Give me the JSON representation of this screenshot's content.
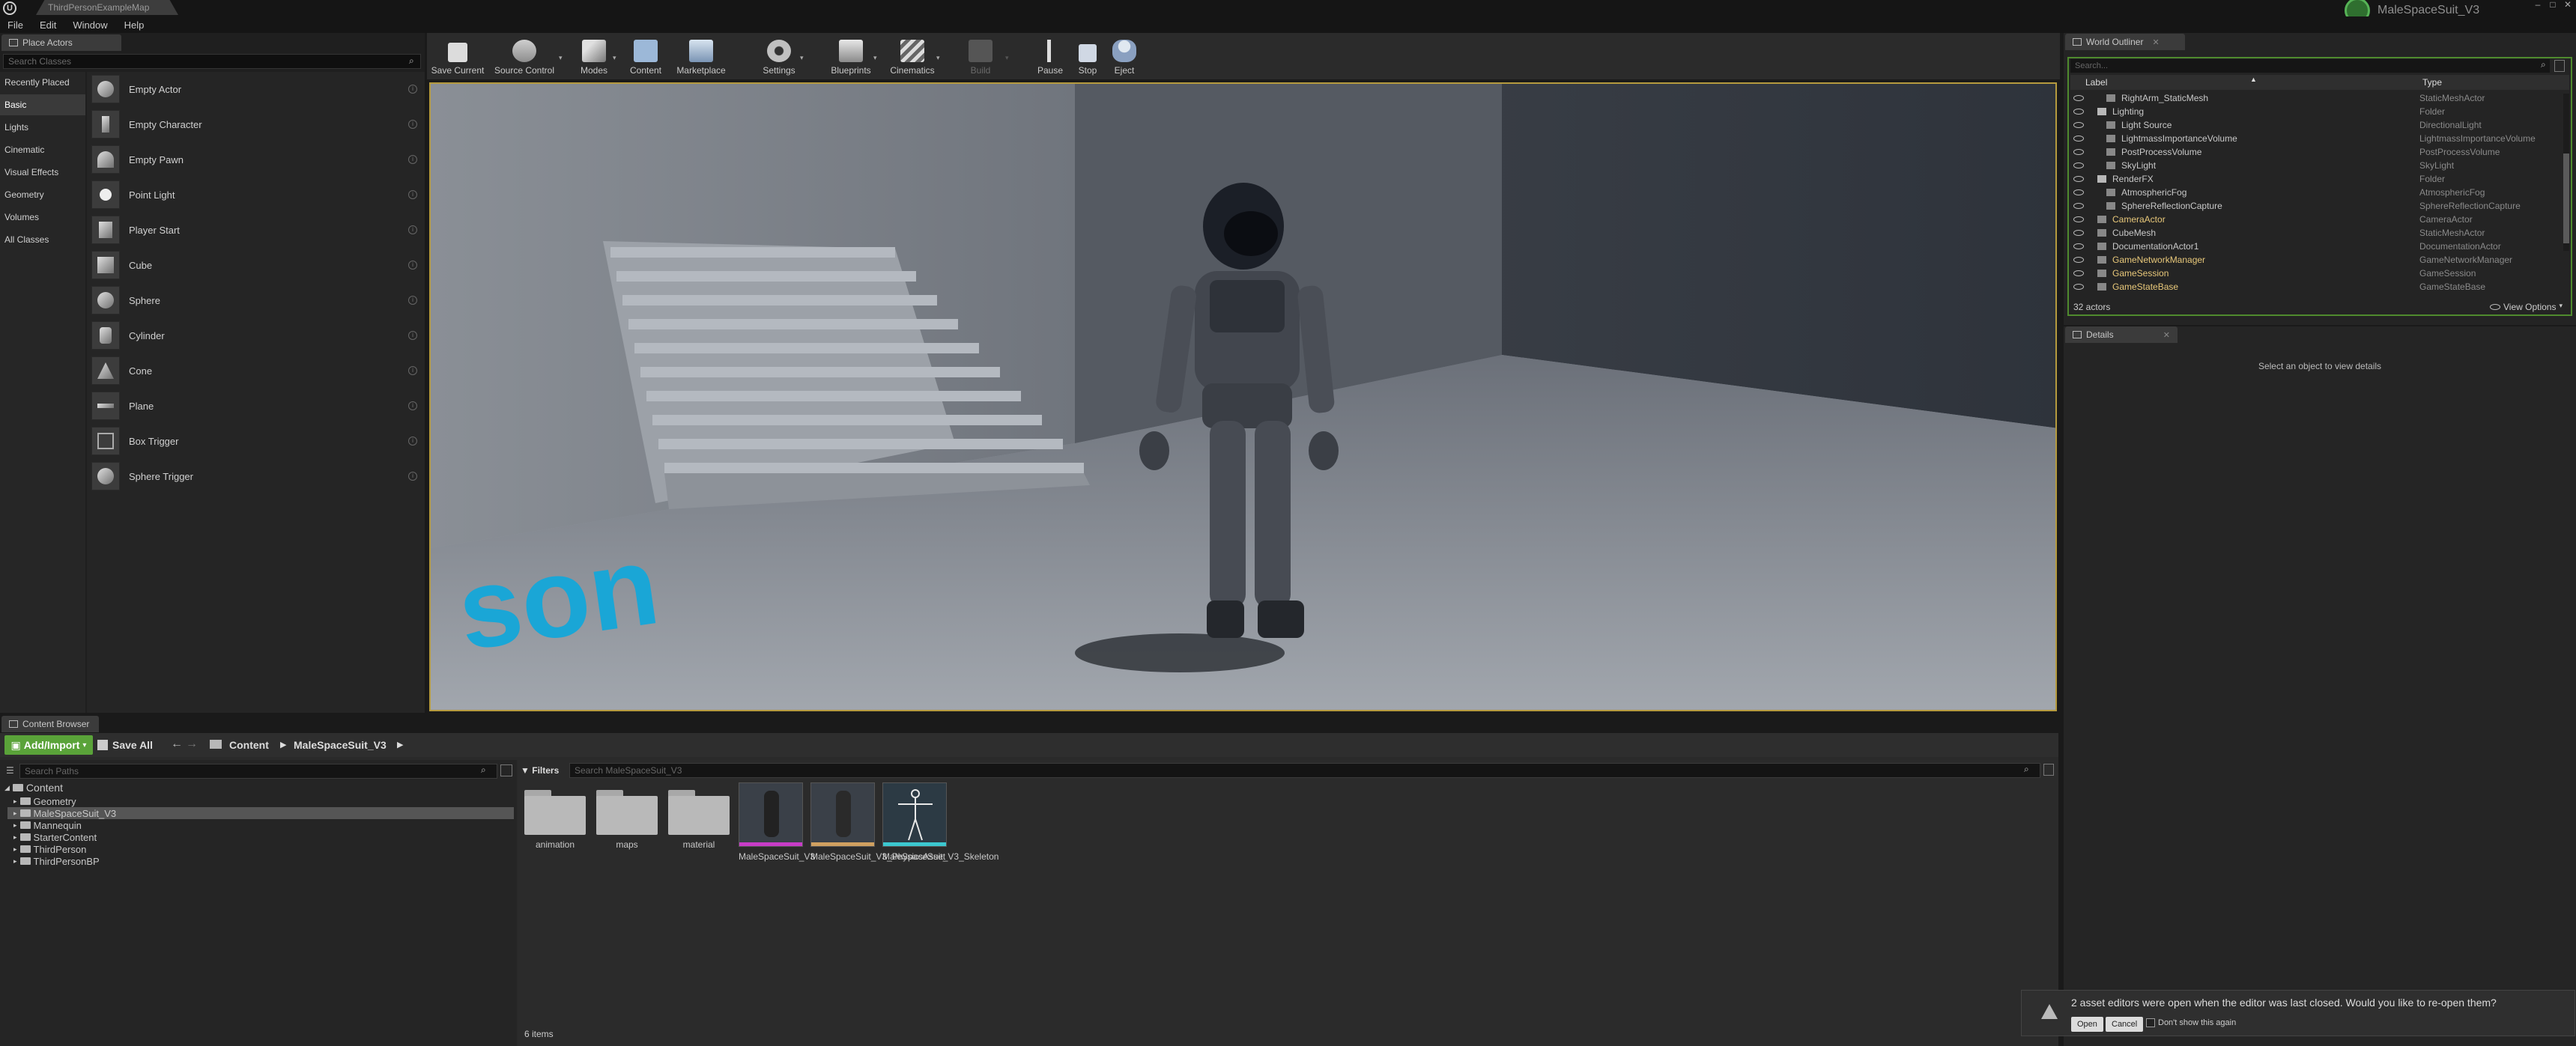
{
  "app": {
    "doc_tab": "ThirdPersonExampleMap",
    "project_name": "MaleSpaceSuit_V3",
    "menu": [
      "File",
      "Edit",
      "Window",
      "Help"
    ]
  },
  "place_actors": {
    "tab_label": "Place Actors",
    "search_placeholder": "Search Classes",
    "categories": [
      "Recently Placed",
      "Basic",
      "Lights",
      "Cinematic",
      "Visual Effects",
      "Geometry",
      "Volumes",
      "All Classes"
    ],
    "active_category": "Basic",
    "items": [
      "Empty Actor",
      "Empty Character",
      "Empty Pawn",
      "Point Light",
      "Player Start",
      "Cube",
      "Sphere",
      "Cylinder",
      "Cone",
      "Plane",
      "Box Trigger",
      "Sphere Trigger"
    ]
  },
  "toolbar": {
    "buttons": [
      {
        "label": "Save Current",
        "icon": "save-icon"
      },
      {
        "label": "Source Control",
        "icon": "source-control-icon"
      },
      {
        "label": "Modes",
        "icon": "modes-icon"
      },
      {
        "label": "Content",
        "icon": "content-icon"
      },
      {
        "label": "Marketplace",
        "icon": "marketplace-icon"
      },
      {
        "label": "Settings",
        "icon": "settings-icon"
      },
      {
        "label": "Blueprints",
        "icon": "blueprints-icon"
      },
      {
        "label": "Cinematics",
        "icon": "cinematics-icon"
      },
      {
        "label": "Build",
        "icon": "build-icon"
      },
      {
        "label": "Pause",
        "icon": "pause-icon"
      },
      {
        "label": "Stop",
        "icon": "stop-icon"
      },
      {
        "label": "Eject",
        "icon": "eject-icon"
      }
    ]
  },
  "viewport": {
    "floor_text": "son"
  },
  "content_browser": {
    "tab_label": "Content Browser",
    "add_import": "Add/Import",
    "save_all": "Save All",
    "breadcrumb": [
      "Content",
      "MaleSpaceSuit_V3"
    ],
    "search_paths_placeholder": "Search Paths",
    "tree": {
      "root": "Content",
      "children": [
        "Geometry",
        "MaleSpaceSuit_V3",
        "Mannequin",
        "StarterContent",
        "ThirdPerson",
        "ThirdPersonBP"
      ],
      "selected": "MaleSpaceSuit_V3"
    },
    "filters_label": "Filters",
    "asset_search_placeholder": "Search MaleSpaceSuit_V3",
    "assets": [
      {
        "type": "folder",
        "label": "animation"
      },
      {
        "type": "folder",
        "label": "maps"
      },
      {
        "type": "folder",
        "label": "material"
      },
      {
        "type": "mesh",
        "label": "MaleSpaceSuit_V3",
        "accent": "#c83cc8"
      },
      {
        "type": "physics",
        "label": "MaleSpaceSuit_V3_PhysicsAsset",
        "accent": "#d0a060"
      },
      {
        "type": "skeleton",
        "label": "MaleSpaceSuit_V3_Skeleton",
        "accent": "#3cc8d0"
      }
    ],
    "item_count": "6 items"
  },
  "world_outliner": {
    "tab_label": "World Outliner",
    "search_placeholder": "Search...",
    "col_label": "Label",
    "col_type": "Type",
    "rows": [
      {
        "label": "RightArm_StaticMesh",
        "type": "StaticMeshActor",
        "indent": 2,
        "highlight": false
      },
      {
        "label": "Lighting",
        "type": "Folder",
        "indent": 1,
        "highlight": false,
        "folder": true
      },
      {
        "label": "Light Source",
        "type": "DirectionalLight",
        "indent": 2,
        "highlight": false
      },
      {
        "label": "LightmassImportanceVolume",
        "type": "LightmassImportanceVolume",
        "indent": 2,
        "highlight": false
      },
      {
        "label": "PostProcessVolume",
        "type": "PostProcessVolume",
        "indent": 2,
        "highlight": false
      },
      {
        "label": "SkyLight",
        "type": "SkyLight",
        "indent": 2,
        "highlight": false
      },
      {
        "label": "RenderFX",
        "type": "Folder",
        "indent": 1,
        "highlight": false,
        "folder": true
      },
      {
        "label": "AtmosphericFog",
        "type": "AtmosphericFog",
        "indent": 2,
        "highlight": false
      },
      {
        "label": "SphereReflectionCapture",
        "type": "SphereReflectionCapture",
        "indent": 2,
        "highlight": false
      },
      {
        "label": "CameraActor",
        "type": "CameraActor",
        "indent": 1,
        "highlight": true
      },
      {
        "label": "CubeMesh",
        "type": "StaticMeshActor",
        "indent": 1,
        "highlight": false
      },
      {
        "label": "DocumentationActor1",
        "type": "DocumentationActor",
        "indent": 1,
        "highlight": false
      },
      {
        "label": "GameNetworkManager",
        "type": "GameNetworkManager",
        "indent": 1,
        "highlight": true
      },
      {
        "label": "GameSession",
        "type": "GameSession",
        "indent": 1,
        "highlight": true
      },
      {
        "label": "GameStateBase",
        "type": "GameStateBase",
        "indent": 1,
        "highlight": true
      }
    ],
    "actor_count": "32 actors",
    "view_options": "View Options"
  },
  "details": {
    "tab_label": "Details",
    "empty_message": "Select an object to view details"
  },
  "notification": {
    "message": "2 asset editors were open when the editor was last closed. Would you like to re-open them?",
    "open": "Open",
    "cancel": "Cancel",
    "dont_show": "Don't show this again"
  },
  "colors": {
    "accent_green": "#5aa339",
    "viewport_border": "#b59a3e",
    "floor_text": "#1aa6d6",
    "highlight_text": "#e8c87a"
  }
}
